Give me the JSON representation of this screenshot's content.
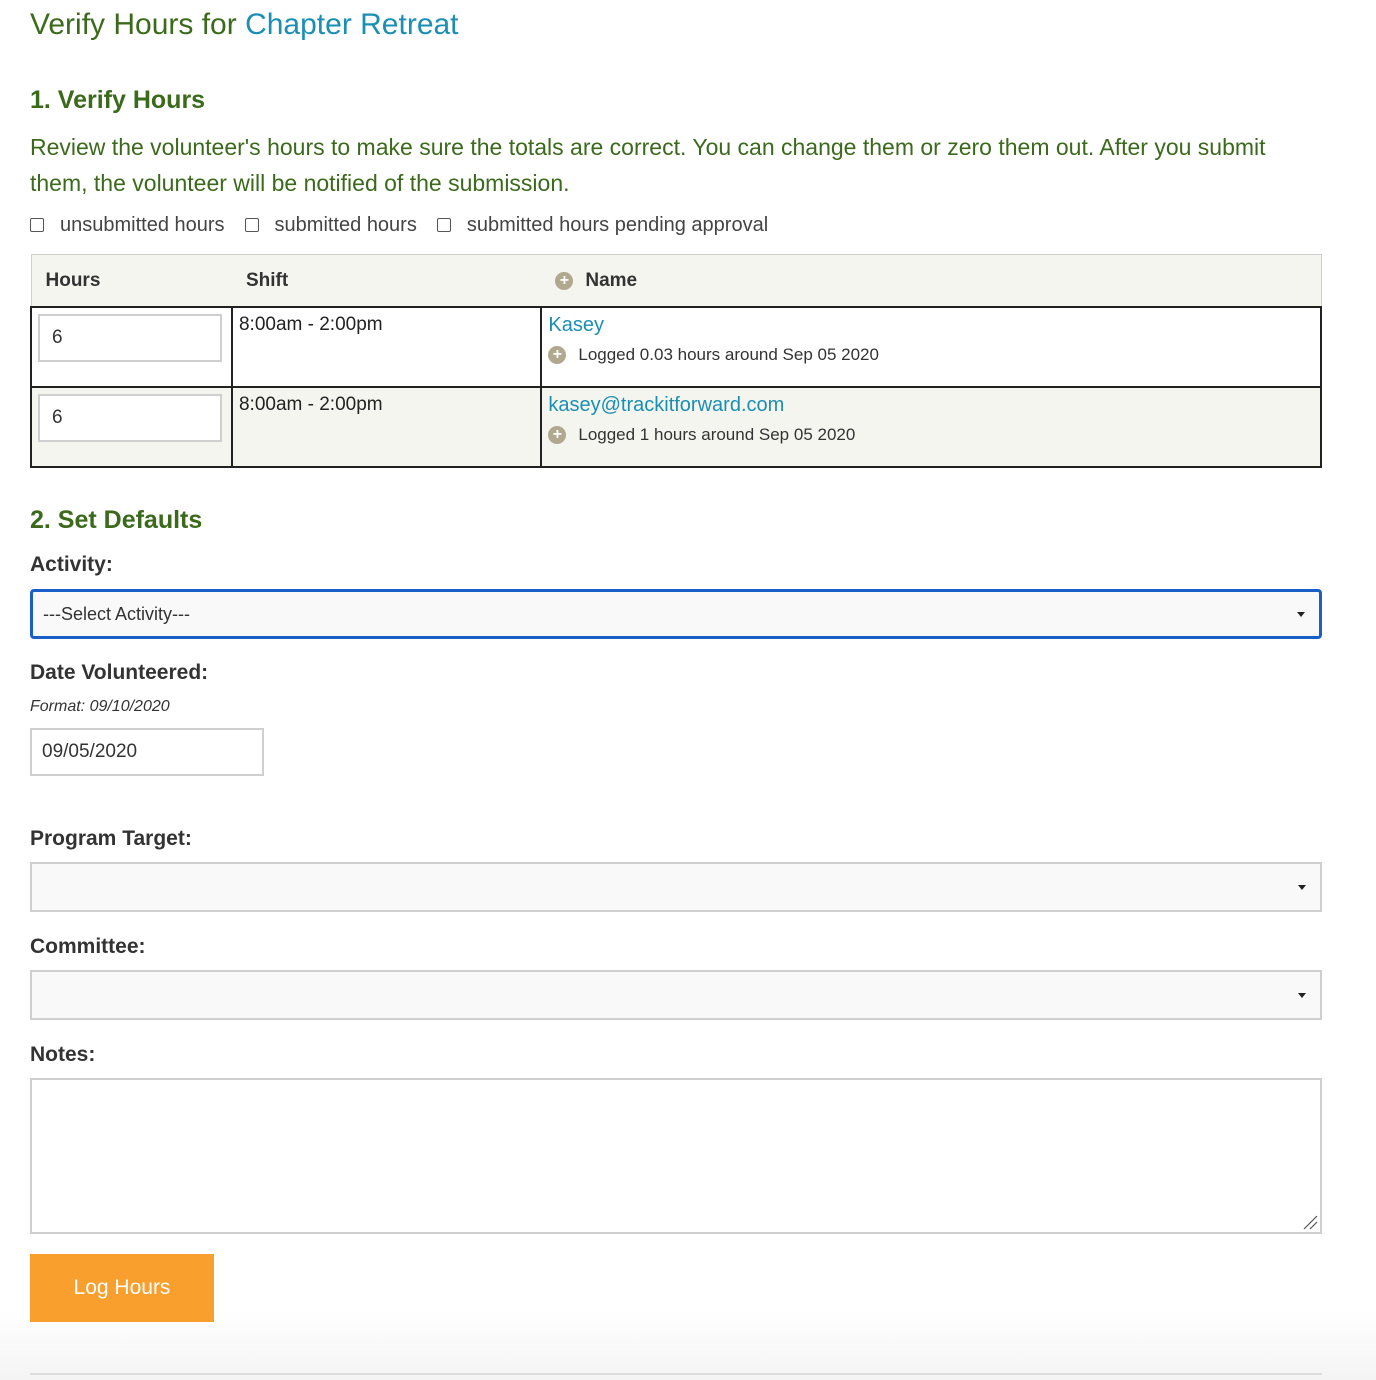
{
  "page": {
    "title_prefix": "Verify Hours for ",
    "event_name": "Chapter Retreat"
  },
  "verify": {
    "heading": "1. Verify Hours",
    "intro": "Review the volunteer's hours to make sure the totals are correct. You can change them or zero them out. After you submit them, the volunteer will be notified of the submission.",
    "filters": [
      "unsubmitted hours",
      "submitted hours",
      "submitted hours pending approval"
    ]
  },
  "table": {
    "columns": [
      "Hours",
      "Shift",
      "Name"
    ],
    "rows": [
      {
        "hours": "6",
        "shift": "8:00am - 2:00pm",
        "name": "Kasey",
        "log": "Logged 0.03 hours around Sep 05 2020"
      },
      {
        "hours": "6",
        "shift": "8:00am - 2:00pm",
        "name": "kasey@trackitforward.com",
        "log": "Logged 1 hours around Sep 05 2020"
      }
    ]
  },
  "defaults": {
    "heading": "2. Set Defaults",
    "activity_label": "Activity:",
    "activity_value": "---Select Activity---",
    "date_label": "Date Volunteered:",
    "date_format": "Format: 09/10/2020",
    "date_value": "09/05/2020",
    "program_label": "Program Target:",
    "program_value": "",
    "committee_label": "Committee:",
    "committee_value": "",
    "notes_label": "Notes:",
    "notes_value": "",
    "submit_label": "Log Hours"
  },
  "colors": {
    "heading_green": "#3b6a1c",
    "link_blue": "#1a8fb3",
    "button_orange": "#f99f2d",
    "focus_blue": "#1a5fc8"
  }
}
